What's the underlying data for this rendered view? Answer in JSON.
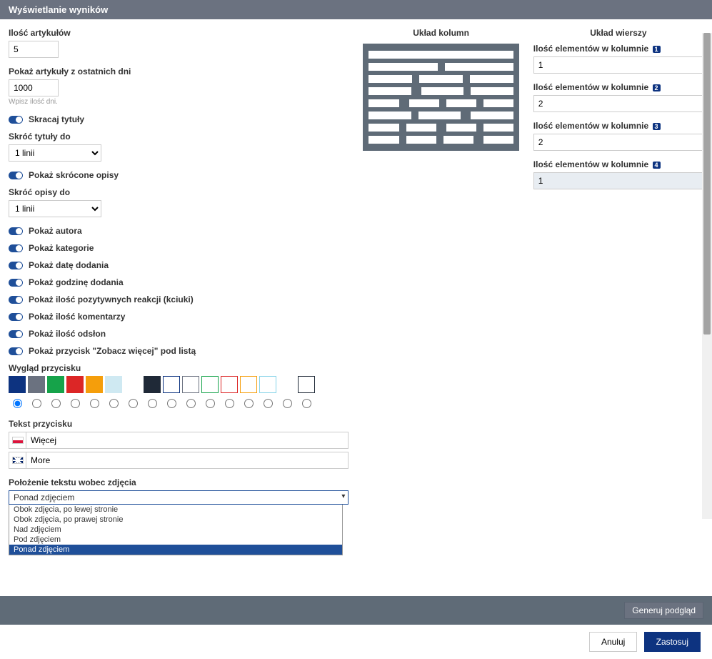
{
  "header": {
    "title": "Wyświetlanie wyników"
  },
  "left": {
    "articles_label": "Ilość artykułów",
    "articles_value": "5",
    "days_label": "Pokaż artykuły z ostatnich dni",
    "days_value": "1000",
    "days_hint": "Wpisz ilość dni.",
    "shorten_titles_toggle": "Skracaj tytuły",
    "shorten_titles_to_label": "Skróć tytuły do",
    "shorten_titles_to_value": "1 linii",
    "show_short_desc_toggle": "Pokaż skrócone opisy",
    "shorten_desc_to_label": "Skróć opisy do",
    "shorten_desc_to_value": "1 linii",
    "toggles": [
      "Pokaż autora",
      "Pokaż kategorie",
      "Pokaż datę dodania",
      "Pokaż godzinę dodania",
      "Pokaż ilość pozytywnych reakcji (kciuki)",
      "Pokaż ilość komentarzy",
      "Pokaż ilość odsłon",
      "Pokaż przycisk \"Zobacz więcej\" pod listą"
    ],
    "button_look_label": "Wygląd przycisku",
    "swatches": [
      {
        "bg": "#0d3380",
        "outlined": false
      },
      {
        "bg": "#6b7280",
        "outlined": false
      },
      {
        "bg": "#16a34a",
        "outlined": false
      },
      {
        "bg": "#dc2626",
        "outlined": false
      },
      {
        "bg": "#f59e0b",
        "outlined": false
      },
      {
        "bg": "#cfe9f2",
        "outlined": false
      },
      {
        "bg": "#ffffff",
        "outlined": false
      },
      {
        "bg": "#1f2937",
        "outlined": false
      },
      {
        "bg": "#ffffff",
        "outlined": true,
        "border": "#0d3380"
      },
      {
        "bg": "#ffffff",
        "outlined": true,
        "border": "#6b7280"
      },
      {
        "bg": "#ffffff",
        "outlined": true,
        "border": "#16a34a"
      },
      {
        "bg": "#ffffff",
        "outlined": true,
        "border": "#dc2626"
      },
      {
        "bg": "#ffffff",
        "outlined": true,
        "border": "#f59e0b"
      },
      {
        "bg": "#ffffff",
        "outlined": true,
        "border": "#86d3e8"
      },
      {
        "bg": "#ffffff",
        "outlined": false
      },
      {
        "bg": "#ffffff",
        "outlined": true,
        "border": "#1f2937"
      }
    ],
    "button_text_label": "Tekst przycisku",
    "button_text_pl": "Więcej",
    "button_text_en": "More",
    "text_position_label": "Położenie tekstu wobec zdjęcia",
    "text_position_value": "Ponad zdjęciem",
    "text_position_options": [
      "Obok zdjęcia, po lewej stronie",
      "Obok zdjęcia, po prawej stronie",
      "Nad zdjęciem",
      "Pod zdjęciem",
      "Ponad zdjęciem"
    ]
  },
  "mid": {
    "heading": "Układ kolumn"
  },
  "right": {
    "heading": "Układ wierszy",
    "fields": [
      {
        "label": "Ilość elementów w kolumnie",
        "badge": "1",
        "value": "1",
        "filled": false
      },
      {
        "label": "Ilość elementów w kolumnie",
        "badge": "2",
        "value": "2",
        "filled": false
      },
      {
        "label": "Ilość elementów w kolumnie",
        "badge": "3",
        "value": "2",
        "filled": false
      },
      {
        "label": "Ilość elementów w kolumnie",
        "badge": "4",
        "value": "1",
        "filled": true
      }
    ]
  },
  "footer": {
    "generate": "Generuj podgląd",
    "cancel": "Anuluj",
    "apply": "Zastosuj"
  }
}
